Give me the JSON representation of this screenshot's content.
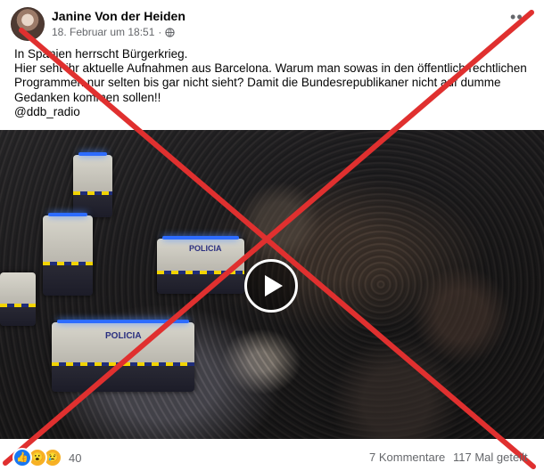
{
  "post": {
    "author": "Janine Von der Heiden",
    "date": "18. Februar um 18:51",
    "date_separator": "·",
    "text_lines": [
      "In Spanien herrscht Bürgerkrieg.",
      "Hier seht ihr aktuelle Aufnahmen aus Barcelona. Warum man sowas in den öffentlich rechtlichen",
      "Programmen nur selten bis gar nicht sieht?  Damit die Bundesrepublikaner nicht auf dumme",
      "Gedanken kommen sollen!!",
      "@ddb_radio"
    ]
  },
  "icons": {
    "privacy": "globe-icon",
    "menu": "more-options-icon",
    "play": "play-icon",
    "reactions": [
      "like-icon",
      "wow-icon",
      "sad-icon"
    ]
  },
  "video": {
    "van_labels": [
      "POLICIA",
      "POLICIA"
    ]
  },
  "overlay": {
    "cross_color": "#e0302f"
  },
  "footer": {
    "reaction_count": "40",
    "comments": "7 Kommentare",
    "shares": "117 Mal geteilt"
  }
}
